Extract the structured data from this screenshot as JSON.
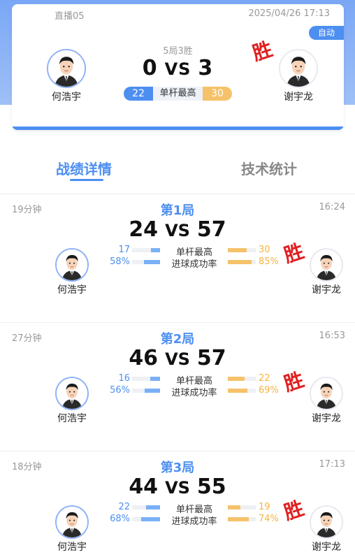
{
  "header": {
    "channel": "直播05",
    "datetime": "2025/04/26 17:13",
    "auto_label": "自动",
    "format": "5局3胜",
    "score_left": "0",
    "score_right": "3",
    "vs": "VS",
    "high_break_label": "单杆最高",
    "high_break_left": "22",
    "high_break_right": "30",
    "win_label": "胜"
  },
  "players": {
    "left": "何浩宇",
    "right": "谢宇龙"
  },
  "tabs": [
    {
      "label": "战绩详情",
      "active": true
    },
    {
      "label": "技术统计",
      "active": false
    }
  ],
  "stat_labels": {
    "high_break": "单杆最高",
    "pot_success": "进球成功率"
  },
  "games": [
    {
      "title": "第1局",
      "duration": "19分钟",
      "end_time": "16:24",
      "score_left": "24",
      "score_right": "57",
      "high_break_left": "17",
      "high_break_right": "30",
      "high_break_left_fill": 0.33,
      "high_break_right_fill": 0.67,
      "pot_left": "58%",
      "pot_right": "85%",
      "pot_left_fill": 0.58,
      "pot_right_fill": 0.85
    },
    {
      "title": "第2局",
      "duration": "27分钟",
      "end_time": "16:53",
      "score_left": "46",
      "score_right": "57",
      "high_break_left": "16",
      "high_break_right": "22",
      "high_break_left_fill": 0.36,
      "high_break_right_fill": 0.6,
      "pot_left": "56%",
      "pot_right": "69%",
      "pot_left_fill": 0.56,
      "pot_right_fill": 0.69
    },
    {
      "title": "第3局",
      "duration": "18分钟",
      "end_time": "17:13",
      "score_left": "44",
      "score_right": "55",
      "high_break_left": "22",
      "high_break_right": "19",
      "high_break_left_fill": 0.5,
      "high_break_right_fill": 0.45,
      "pot_left": "68%",
      "pot_right": "74%",
      "pot_left_fill": 0.68,
      "pot_right_fill": 0.74
    }
  ],
  "colors": {
    "accent_blue": "#4d8ff0",
    "accent_gold": "#f5c26b",
    "win_red": "#e02020"
  }
}
